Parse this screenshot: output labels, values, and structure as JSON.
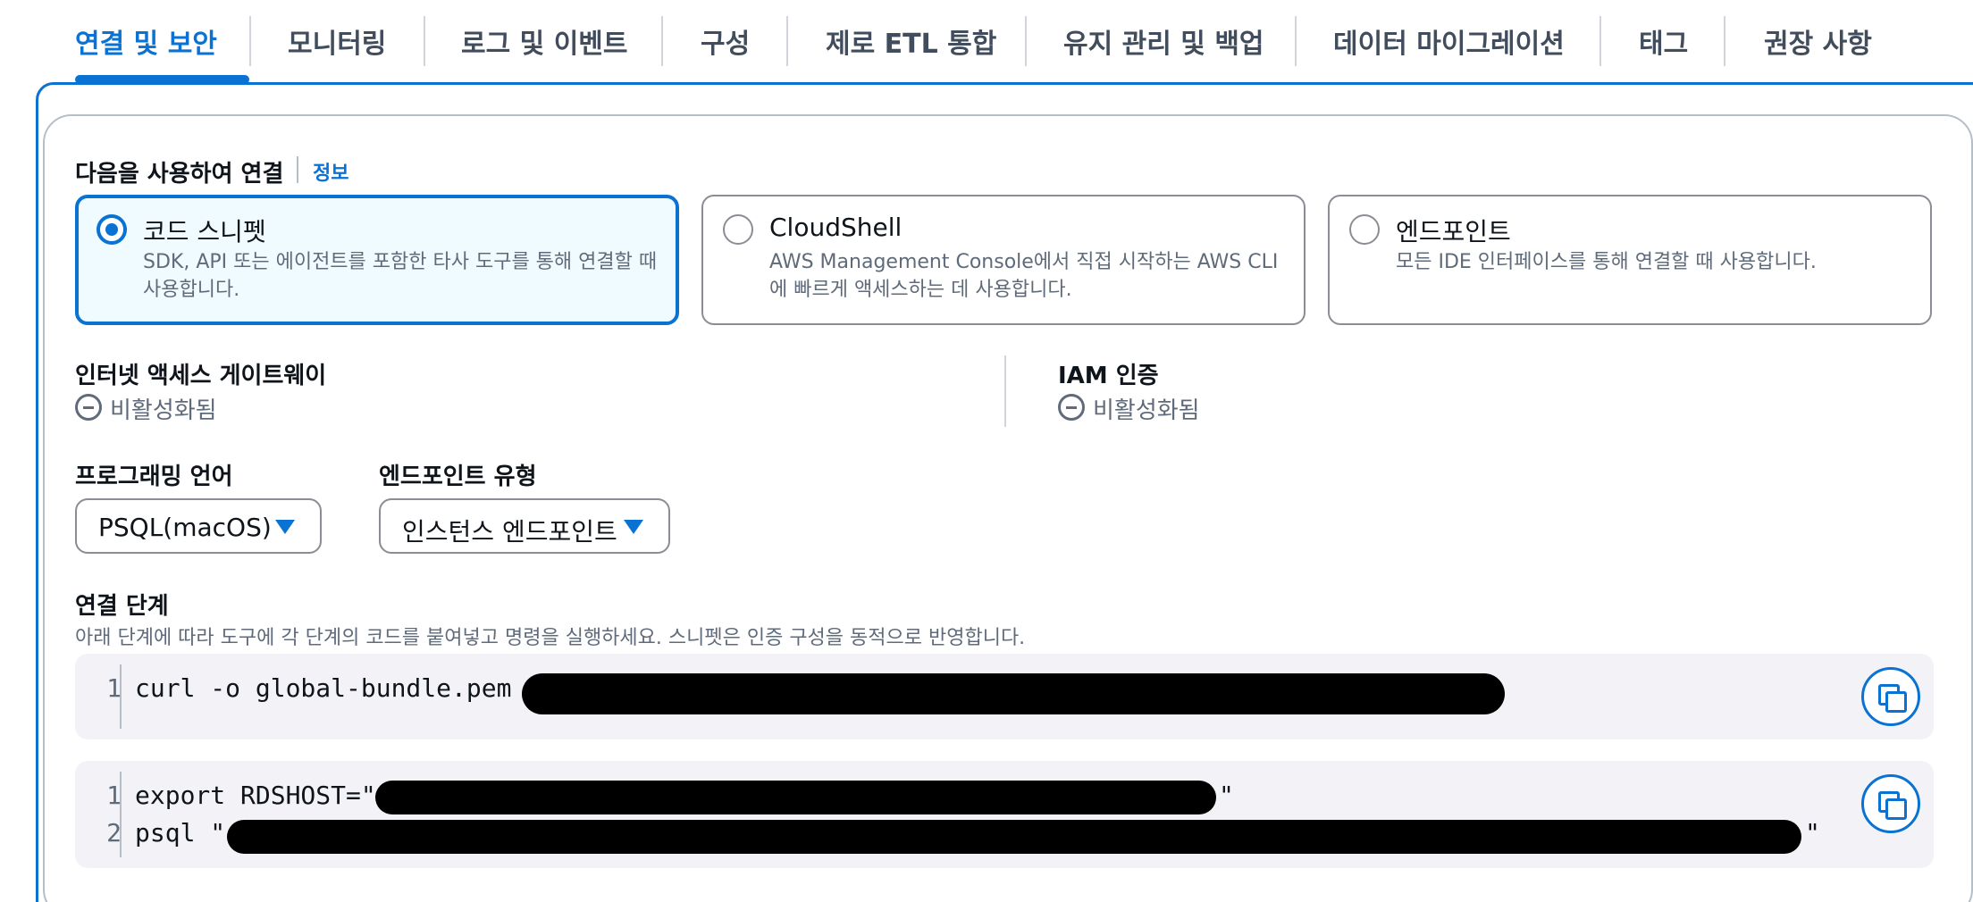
{
  "tabs": [
    {
      "label": "연결 및 보안"
    },
    {
      "label": "모니터링"
    },
    {
      "label": "로그 및 이벤트"
    },
    {
      "label": "구성"
    },
    {
      "label": "제로 ETL 통합"
    },
    {
      "label": "유지 관리 및 백업"
    },
    {
      "label": "데이터 마이그레이션"
    },
    {
      "label": "태그"
    },
    {
      "label": "권장 사항"
    }
  ],
  "connect": {
    "label": "다음을 사용하여 연결",
    "info_link": "정보",
    "options": [
      {
        "title": "코드 스니펫",
        "desc": "SDK, API 또는 에이전트를 포함한 타사 도구를 통해 연결할 때 사용합니다.",
        "selected": true
      },
      {
        "title": "CloudShell",
        "desc": "AWS Management Console에서 직접 시작하는 AWS CLI에 빠르게 액세스하는 데 사용합니다.",
        "selected": false
      },
      {
        "title": "엔드포인트",
        "desc": "모든 IDE 인터페이스를 통해 연결할 때 사용합니다.",
        "selected": false
      }
    ]
  },
  "internet_gateway": {
    "label": "인터넷 액세스 게이트웨이",
    "status": "비활성화됨"
  },
  "iam_auth": {
    "label": "IAM 인증",
    "status": "비활성화됨"
  },
  "language": {
    "label": "프로그래밍 언어",
    "value": "PSQL(macOS)"
  },
  "endpoint_type": {
    "label": "엔드포인트 유형",
    "value": "인스턴스 엔드포인트"
  },
  "steps": {
    "label": "연결 단계",
    "desc": "아래 단계에 따라 도구에 각 단계의 코드를 붙여넣고 명령을 실행하세요. 스니펫은 인증 구성을 동적으로 반영합니다.",
    "block1": {
      "line_numbers": [
        "1"
      ],
      "lines": [
        "curl -o global-bundle.pem "
      ]
    },
    "block2": {
      "line_numbers": [
        "1",
        "2"
      ],
      "lines": [
        "export RDSHOST=\"",
        "psql \""
      ],
      "line_ends": [
        "\"",
        "\""
      ]
    }
  }
}
